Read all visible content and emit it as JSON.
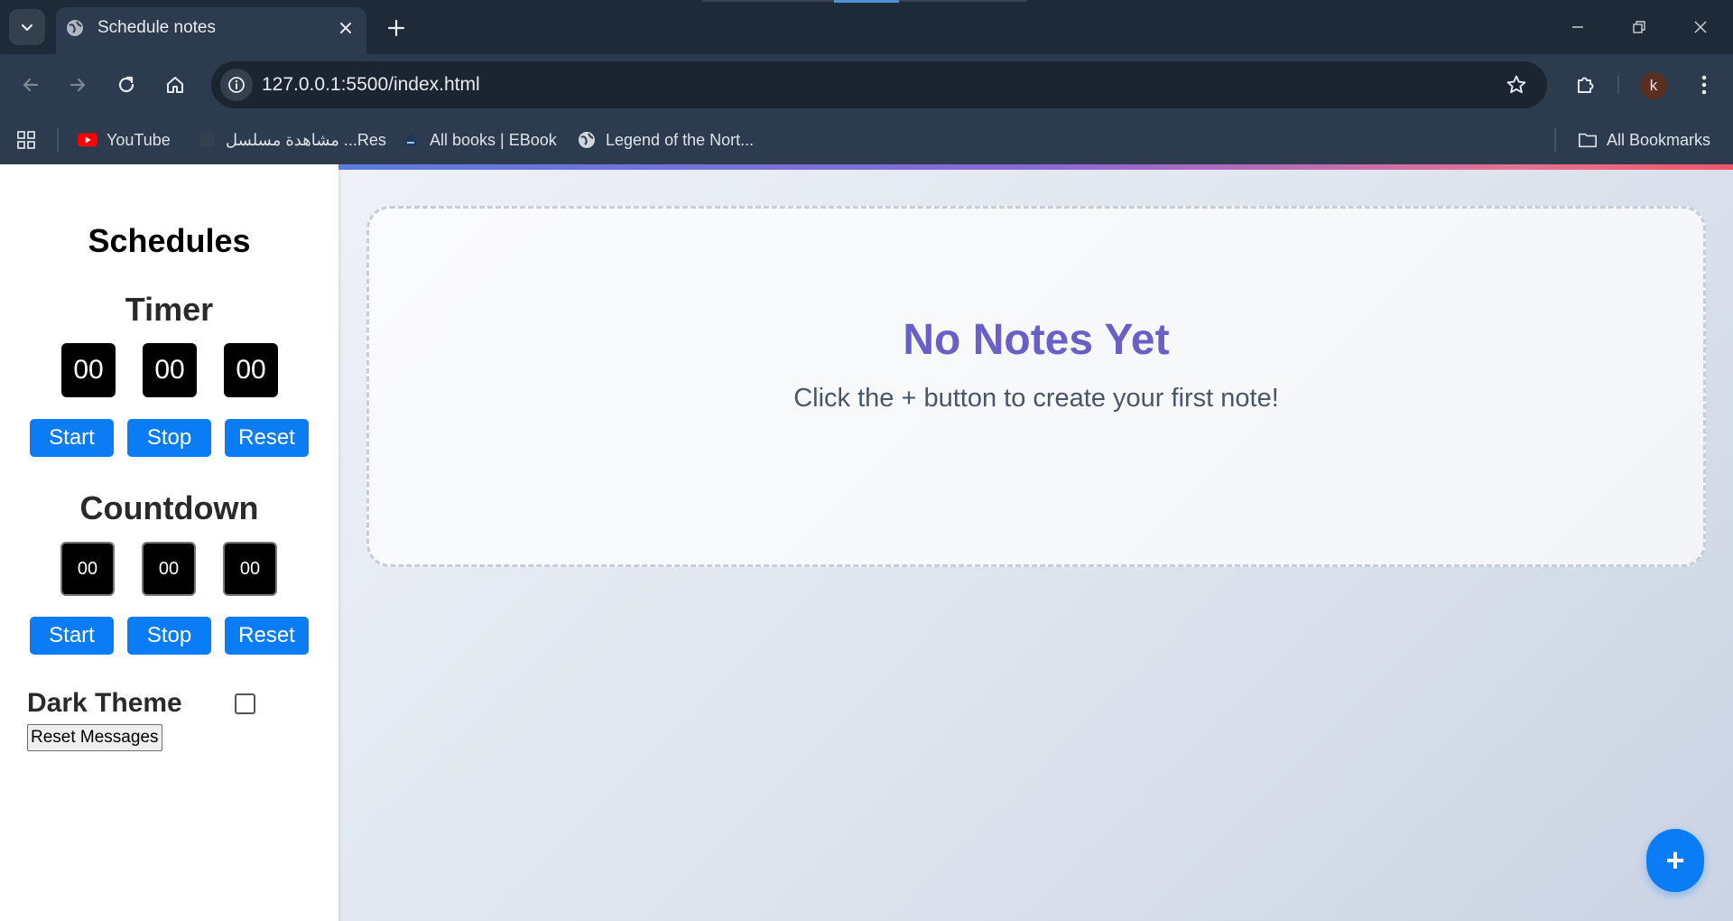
{
  "browser": {
    "tab_title": "Schedule notes",
    "url": "127.0.0.1:5500/index.html",
    "profile_initial": "k",
    "bookmarks": [
      {
        "label": "YouTube",
        "icon": "youtube-icon"
      },
      {
        "label": "مشاهدة مسلسل ...Res",
        "icon": "site-icon"
      },
      {
        "label": "All books | EBook",
        "icon": "book-site-icon"
      },
      {
        "label": "Legend of the Nort...",
        "icon": "globe-icon"
      }
    ],
    "all_bookmarks_label": "All Bookmarks"
  },
  "sidebar": {
    "title": "Schedules",
    "timer": {
      "heading": "Timer",
      "hours": "00",
      "minutes": "00",
      "seconds": "00",
      "start_label": "Start",
      "stop_label": "Stop",
      "reset_label": "Reset"
    },
    "countdown": {
      "heading": "Countdown",
      "hours": "00",
      "minutes": "00",
      "seconds": "00",
      "start_label": "Start",
      "stop_label": "Stop",
      "reset_label": "Reset"
    },
    "dark_theme_label": "Dark Theme",
    "dark_theme_checked": false,
    "reset_messages_label": "Reset Messages"
  },
  "main": {
    "empty_title": "No Notes Yet",
    "empty_subtitle": "Click the + button to create your first note!",
    "add_button_label": "+"
  },
  "colors": {
    "accent_blue": "#0a7cf5",
    "empty_title": "#6a5fc7",
    "chrome_dark": "#1f2a38",
    "chrome_toolbar": "#2c3b4d"
  }
}
